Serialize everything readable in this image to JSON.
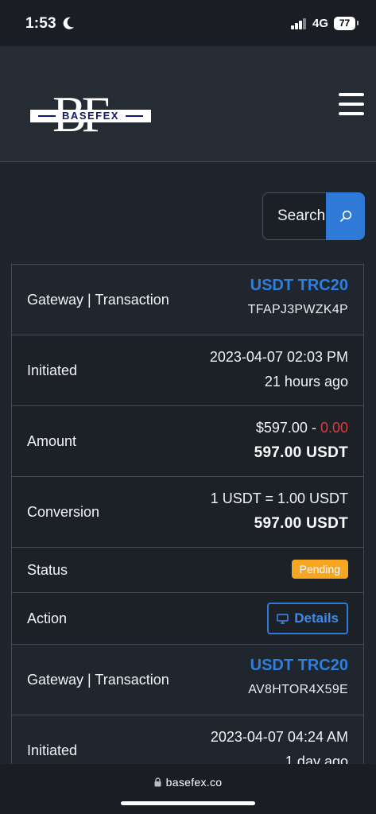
{
  "status_bar": {
    "time": "1:53",
    "network": "4G",
    "battery": "77"
  },
  "header": {
    "logo_letters": "BF",
    "logo_text": "BASEFEX"
  },
  "search": {
    "placeholder": "Search"
  },
  "transactions": [
    {
      "gateway_label": "Gateway | Transaction",
      "gateway": "USDT TRC20",
      "trx": "TFAPJ3PWZK4P",
      "initiated_label": "Initiated",
      "date": "2023-04-07 02:03 PM",
      "ago": "21 hours ago",
      "amount_label": "Amount",
      "amount": "$597.00",
      "amount_sep": " - ",
      "charge": "0.00",
      "amount_total": "597.00 USDT",
      "conversion_label": "Conversion",
      "rate": "1 USDT = 1.00 USDT",
      "converted": "597.00 USDT",
      "status_label": "Status",
      "status": "Pending",
      "action_label": "Action",
      "action_button": "Details"
    },
    {
      "gateway_label": "Gateway | Transaction",
      "gateway": "USDT TRC20",
      "trx": "AV8HTOR4X59E",
      "initiated_label": "Initiated",
      "date": "2023-04-07 04:24 AM",
      "ago": "1 day ago"
    }
  ],
  "browser": {
    "url": "basefex.co"
  },
  "colors": {
    "accent": "#2f7ad6",
    "pending": "#f5a623",
    "charge": "#e03b3b",
    "background": "#1f252d"
  }
}
